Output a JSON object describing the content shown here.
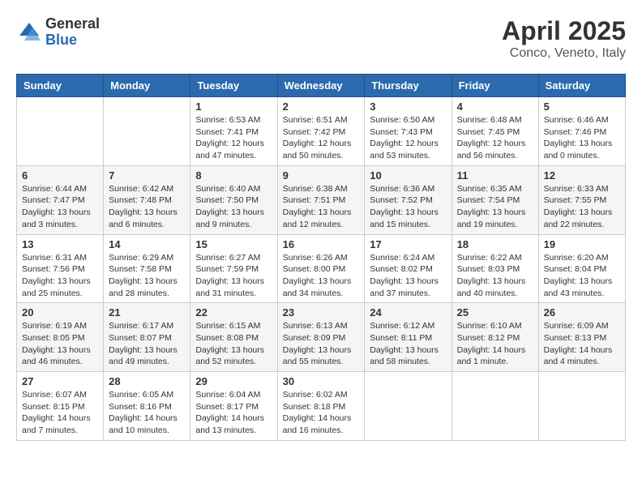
{
  "logo": {
    "general": "General",
    "blue": "Blue"
  },
  "title": "April 2025",
  "location": "Conco, Veneto, Italy",
  "weekdays": [
    "Sunday",
    "Monday",
    "Tuesday",
    "Wednesday",
    "Thursday",
    "Friday",
    "Saturday"
  ],
  "weeks": [
    [
      {
        "day": "",
        "info": ""
      },
      {
        "day": "",
        "info": ""
      },
      {
        "day": "1",
        "info": "Sunrise: 6:53 AM\nSunset: 7:41 PM\nDaylight: 12 hours and 47 minutes."
      },
      {
        "day": "2",
        "info": "Sunrise: 6:51 AM\nSunset: 7:42 PM\nDaylight: 12 hours and 50 minutes."
      },
      {
        "day": "3",
        "info": "Sunrise: 6:50 AM\nSunset: 7:43 PM\nDaylight: 12 hours and 53 minutes."
      },
      {
        "day": "4",
        "info": "Sunrise: 6:48 AM\nSunset: 7:45 PM\nDaylight: 12 hours and 56 minutes."
      },
      {
        "day": "5",
        "info": "Sunrise: 6:46 AM\nSunset: 7:46 PM\nDaylight: 13 hours and 0 minutes."
      }
    ],
    [
      {
        "day": "6",
        "info": "Sunrise: 6:44 AM\nSunset: 7:47 PM\nDaylight: 13 hours and 3 minutes."
      },
      {
        "day": "7",
        "info": "Sunrise: 6:42 AM\nSunset: 7:48 PM\nDaylight: 13 hours and 6 minutes."
      },
      {
        "day": "8",
        "info": "Sunrise: 6:40 AM\nSunset: 7:50 PM\nDaylight: 13 hours and 9 minutes."
      },
      {
        "day": "9",
        "info": "Sunrise: 6:38 AM\nSunset: 7:51 PM\nDaylight: 13 hours and 12 minutes."
      },
      {
        "day": "10",
        "info": "Sunrise: 6:36 AM\nSunset: 7:52 PM\nDaylight: 13 hours and 15 minutes."
      },
      {
        "day": "11",
        "info": "Sunrise: 6:35 AM\nSunset: 7:54 PM\nDaylight: 13 hours and 19 minutes."
      },
      {
        "day": "12",
        "info": "Sunrise: 6:33 AM\nSunset: 7:55 PM\nDaylight: 13 hours and 22 minutes."
      }
    ],
    [
      {
        "day": "13",
        "info": "Sunrise: 6:31 AM\nSunset: 7:56 PM\nDaylight: 13 hours and 25 minutes."
      },
      {
        "day": "14",
        "info": "Sunrise: 6:29 AM\nSunset: 7:58 PM\nDaylight: 13 hours and 28 minutes."
      },
      {
        "day": "15",
        "info": "Sunrise: 6:27 AM\nSunset: 7:59 PM\nDaylight: 13 hours and 31 minutes."
      },
      {
        "day": "16",
        "info": "Sunrise: 6:26 AM\nSunset: 8:00 PM\nDaylight: 13 hours and 34 minutes."
      },
      {
        "day": "17",
        "info": "Sunrise: 6:24 AM\nSunset: 8:02 PM\nDaylight: 13 hours and 37 minutes."
      },
      {
        "day": "18",
        "info": "Sunrise: 6:22 AM\nSunset: 8:03 PM\nDaylight: 13 hours and 40 minutes."
      },
      {
        "day": "19",
        "info": "Sunrise: 6:20 AM\nSunset: 8:04 PM\nDaylight: 13 hours and 43 minutes."
      }
    ],
    [
      {
        "day": "20",
        "info": "Sunrise: 6:19 AM\nSunset: 8:05 PM\nDaylight: 13 hours and 46 minutes."
      },
      {
        "day": "21",
        "info": "Sunrise: 6:17 AM\nSunset: 8:07 PM\nDaylight: 13 hours and 49 minutes."
      },
      {
        "day": "22",
        "info": "Sunrise: 6:15 AM\nSunset: 8:08 PM\nDaylight: 13 hours and 52 minutes."
      },
      {
        "day": "23",
        "info": "Sunrise: 6:13 AM\nSunset: 8:09 PM\nDaylight: 13 hours and 55 minutes."
      },
      {
        "day": "24",
        "info": "Sunrise: 6:12 AM\nSunset: 8:11 PM\nDaylight: 13 hours and 58 minutes."
      },
      {
        "day": "25",
        "info": "Sunrise: 6:10 AM\nSunset: 8:12 PM\nDaylight: 14 hours and 1 minute."
      },
      {
        "day": "26",
        "info": "Sunrise: 6:09 AM\nSunset: 8:13 PM\nDaylight: 14 hours and 4 minutes."
      }
    ],
    [
      {
        "day": "27",
        "info": "Sunrise: 6:07 AM\nSunset: 8:15 PM\nDaylight: 14 hours and 7 minutes."
      },
      {
        "day": "28",
        "info": "Sunrise: 6:05 AM\nSunset: 8:16 PM\nDaylight: 14 hours and 10 minutes."
      },
      {
        "day": "29",
        "info": "Sunrise: 6:04 AM\nSunset: 8:17 PM\nDaylight: 14 hours and 13 minutes."
      },
      {
        "day": "30",
        "info": "Sunrise: 6:02 AM\nSunset: 8:18 PM\nDaylight: 14 hours and 16 minutes."
      },
      {
        "day": "",
        "info": ""
      },
      {
        "day": "",
        "info": ""
      },
      {
        "day": "",
        "info": ""
      }
    ]
  ]
}
